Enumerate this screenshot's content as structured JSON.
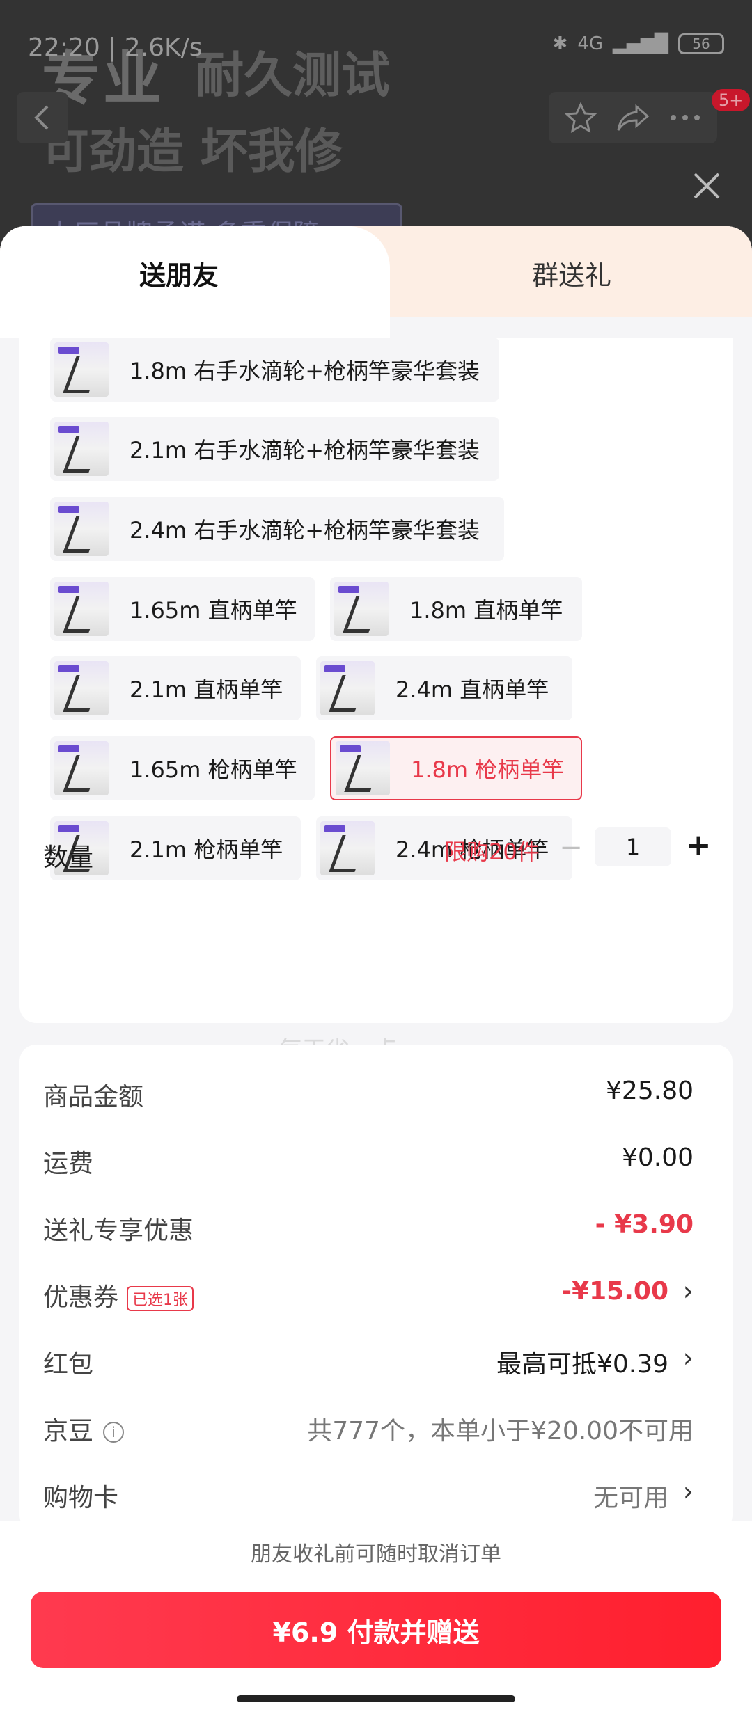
{
  "status_bar": {
    "time": "22:20",
    "speed": "2.6K/s",
    "network": "4G",
    "battery": "56"
  },
  "background": {
    "title": "专业",
    "title2": "耐久测试",
    "subtitle": "可劲造 坏我修",
    "banner": "大厂品牌承诺 多重保障"
  },
  "header": {
    "notification_badge": "5+"
  },
  "tabs": {
    "send_friend": "送朋友",
    "group_gift": "群送礼"
  },
  "variants": [
    {
      "label": "1.8m 右手水滴轮+枪柄竿豪华套装",
      "selected": false
    },
    {
      "label": "2.1m 右手水滴轮+枪柄竿豪华套装",
      "selected": false
    },
    {
      "label": "2.4m 右手水滴轮+枪柄竿豪华套装",
      "selected": false
    },
    {
      "label": "1.65m 直柄单竿",
      "selected": false
    },
    {
      "label": "1.8m 直柄单竿",
      "selected": false
    },
    {
      "label": "2.1m 直柄单竿",
      "selected": false
    },
    {
      "label": "2.4m 直柄单竿",
      "selected": false
    },
    {
      "label": "1.65m 枪柄单竿",
      "selected": false
    },
    {
      "label": "1.8m 枪柄单竿",
      "selected": true
    },
    {
      "label": "2.1m 枪柄单竿",
      "selected": false
    },
    {
      "label": "2.4m 枪柄单竿",
      "selected": false
    }
  ],
  "watermark": "每天省一点",
  "quantity": {
    "label": "数量",
    "limit": "限购20件",
    "value": "1",
    "minus": "−",
    "plus": "+"
  },
  "price": {
    "goods_label": "商品金额",
    "goods_value": "¥25.80",
    "shipping_label": "运费",
    "shipping_value": "¥0.00",
    "gift_discount_label": "送礼专享优惠",
    "gift_discount_value": "- ¥3.90",
    "coupon_label": "优惠券",
    "coupon_tag": "已选1张",
    "coupon_value": "-¥15.00",
    "redpacket_label": "红包",
    "redpacket_value": "最高可抵¥0.39",
    "jingdou_label": "京豆",
    "jingdou_value": "共777个，本单小于¥20.00不可用",
    "card_label": "购物卡",
    "card_value": "无可用"
  },
  "footer": {
    "notice": "朋友收礼前可随时取消订单",
    "pay_button": "¥6.9 付款并赠送"
  },
  "colors": {
    "accent": "#e8394a",
    "tab_bg": "#fdeee4"
  }
}
